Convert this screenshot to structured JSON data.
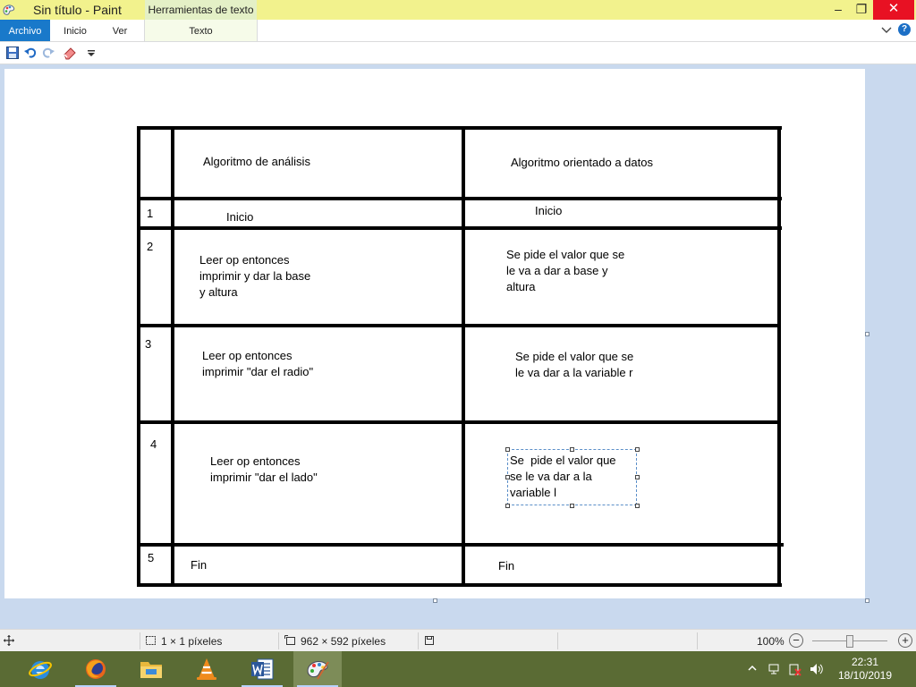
{
  "window": {
    "title": "Sin título - Paint",
    "context_tab_header": "Herramientas de texto",
    "controls": {
      "minimize": "–",
      "maximize": "❐",
      "close": "✕"
    }
  },
  "ribbon": {
    "tabs": [
      {
        "label": "Archivo"
      },
      {
        "label": "Inicio"
      },
      {
        "label": "Ver"
      },
      {
        "label": "Texto"
      }
    ],
    "help_label": "?"
  },
  "quick_access": {
    "icons": [
      "save-icon",
      "undo-icon",
      "redo-icon",
      "eraser-icon",
      "customize-dropdown-icon"
    ]
  },
  "table": {
    "headers": [
      "",
      "Algoritmo de análisis",
      "Algoritmo orientado a datos"
    ],
    "rows": [
      {
        "num": "1",
        "analysis": "Inicio",
        "data": "Inicio"
      },
      {
        "num": "2",
        "analysis": "Leer op entonces\nimprimir y dar la base\ny altura",
        "data": "Se pide el valor que se\nle va a dar a base y\naltura"
      },
      {
        "num": "3",
        "analysis": "Leer op entonces\nimprimir \"dar el radio\"",
        "data": "Se pide el valor que se\nle va dar a la variable r"
      },
      {
        "num": "4",
        "analysis": "Leer op entonces\nimprimir \"dar el lado\"",
        "data": "Se  pide el valor que\nse le va dar a la\nvariable l"
      },
      {
        "num": "5",
        "analysis": "Fin",
        "data": "Fin"
      }
    ]
  },
  "statusbar": {
    "selection_size": "1 × 1 píxeles",
    "canvas_size": "962 × 592 píxeles",
    "zoom": "100%",
    "zoom_out": "−",
    "zoom_in": "+"
  },
  "taskbar": {
    "apps": [
      "internet-explorer-icon",
      "firefox-icon",
      "file-explorer-icon",
      "vlc-icon",
      "word-icon",
      "paint-icon"
    ],
    "time": "22:31",
    "date": "18/10/2019"
  },
  "colors": {
    "title_bar": "#f2f28d",
    "file_tab": "#1979ca",
    "canvas_bg": "#c9d9ee",
    "taskbar": "#5a6b34"
  }
}
